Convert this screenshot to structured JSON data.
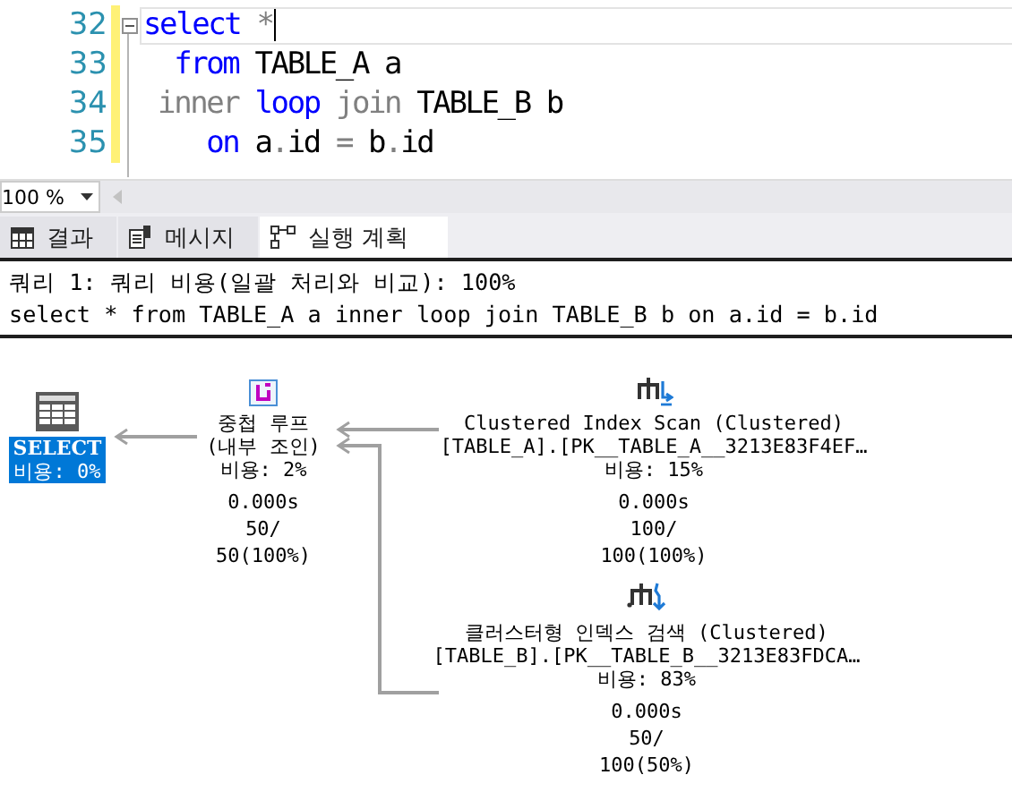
{
  "editor": {
    "lines": [
      {
        "number": "32",
        "current": true,
        "changed": true,
        "collapsible": true,
        "tokens": [
          {
            "text": "select",
            "kind": "keyword"
          },
          {
            "text": " *",
            "kind": "gray"
          }
        ]
      },
      {
        "number": "33",
        "current": false,
        "changed": true,
        "collapsible": false,
        "tokens": [
          {
            "text": "  from",
            "kind": "keyword"
          },
          {
            "text": " TABLE_A a",
            "kind": "plain"
          }
        ]
      },
      {
        "number": "34",
        "current": false,
        "changed": true,
        "collapsible": false,
        "tokens": [
          {
            "text": " inner",
            "kind": "gray"
          },
          {
            "text": " loop",
            "kind": "keyword"
          },
          {
            "text": " join",
            "kind": "gray"
          },
          {
            "text": " TABLE_B b",
            "kind": "plain"
          }
        ]
      },
      {
        "number": "35",
        "current": false,
        "changed": true,
        "collapsible": false,
        "tokens": [
          {
            "text": "    on",
            "kind": "keyword"
          },
          {
            "text": " a",
            "kind": "plain"
          },
          {
            "text": ".",
            "kind": "gray"
          },
          {
            "text": "id ",
            "kind": "plain"
          },
          {
            "text": "=",
            "kind": "gray"
          },
          {
            "text": " b",
            "kind": "plain"
          },
          {
            "text": ".",
            "kind": "gray"
          },
          {
            "text": "id",
            "kind": "plain"
          }
        ]
      }
    ]
  },
  "zoom": {
    "value": "100 %"
  },
  "tabs": [
    {
      "label": "결과",
      "kind": "grid",
      "selected": false
    },
    {
      "label": "메시지",
      "kind": "message",
      "selected": false
    },
    {
      "label": "실행 계획",
      "kind": "plan",
      "selected": true
    }
  ],
  "plan": {
    "header": [
      "쿼리 1: 쿼리 비용(일괄 처리와 비교): 100%",
      "select * from TABLE_A a inner loop join TABLE_B b on a.id = b.id"
    ],
    "nodes": [
      {
        "kind": "select",
        "title_lines": [
          "SELECT"
        ],
        "cost": "비용: 0%",
        "selected": true
      },
      {
        "kind": "nested-loops",
        "title_lines": [
          "중첩 루프",
          "(내부 조인)"
        ],
        "cost": "비용: 2%",
        "selected": false,
        "stats": [
          "0.000s",
          "50/",
          "50(100%)"
        ]
      },
      {
        "kind": "index-scan",
        "title_lines": [
          "Clustered Index Scan (Clustered)",
          "[TABLE_A].[PK__TABLE_A__3213E83F4EF…"
        ],
        "cost": "비용: 15%",
        "selected": false,
        "stats": [
          "0.000s",
          "100/",
          "100(100%)"
        ]
      },
      {
        "kind": "index-seek",
        "title_lines": [
          "클러스터형 인덱스 검색 (Clustered)",
          "[TABLE_B].[PK__TABLE_B__3213E83FDCA…"
        ],
        "cost": "비용: 83%",
        "selected": false,
        "stats": [
          "0.000s",
          "50/",
          "100(50%)"
        ]
      }
    ]
  }
}
